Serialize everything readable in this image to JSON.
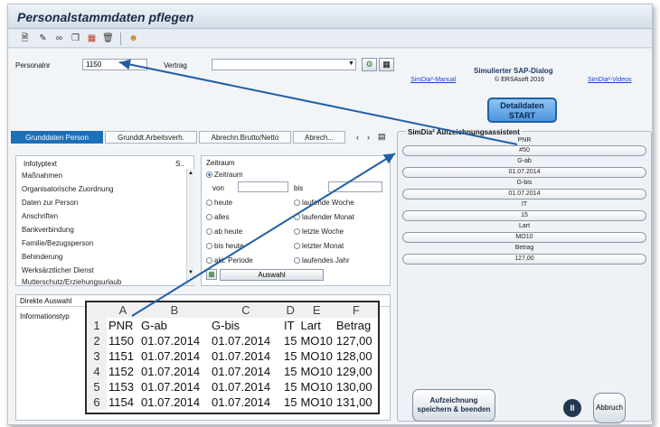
{
  "window": {
    "title": "Personalstammdaten pflegen"
  },
  "toolbar": {
    "icons": [
      "new-document-icon",
      "edit-pencil-icon",
      "glasses-icon",
      "copy-icon",
      "overview-icon",
      "delete-trash-icon",
      "person-icon"
    ]
  },
  "header": {
    "personalnr_label": "Personalnr",
    "personalnr_value": "1150",
    "vertrag_label": "Vertrag",
    "vertrag_value": ""
  },
  "simdia": {
    "heading": "Simulierter SAP-Dialog",
    "copyright": "© ERSAsoft 2016",
    "manual_link": "SimDia²-Manual",
    "videos_link": "SimDia²-Videos",
    "detail_button_line1": "Detaildaten",
    "detail_button_line2": "START",
    "assistant_title": "SimDia² Aufzeichnungsassistent",
    "fields": [
      {
        "label": "PNR",
        "value": "#50"
      },
      {
        "label": "G-ab",
        "value": "01.07.2014"
      },
      {
        "label": "G-bis",
        "value": "01.07.2014"
      },
      {
        "label": "IT",
        "value": "15"
      },
      {
        "label": "Lart",
        "value": "MO10"
      },
      {
        "label": "Betrag",
        "value": "127,00"
      }
    ],
    "save_button_line1": "Aufzeichnung",
    "save_button_line2": "speichern & beenden",
    "cancel_button": "Abbruch"
  },
  "tabs": [
    {
      "label": "Grunddaten Person",
      "active": true
    },
    {
      "label": "Grunddt.Arbeitsverh.",
      "active": false
    },
    {
      "label": "Abrechn.Brutto/Netto",
      "active": false
    },
    {
      "label": "Abrech...",
      "active": false
    }
  ],
  "infotypes": {
    "col_label": "Infotyptext",
    "col_status": "S..",
    "items": [
      "Maßnahmen",
      "Organisatorische Zuordnung",
      "Daten zur Person",
      "Anschriften",
      "Bankverbindung",
      "Familie/Bezugsperson",
      "Behinderung",
      "Werksärztlicher Dienst",
      "Mutterschutz/Erziehungsurlaub"
    ]
  },
  "zeitraum": {
    "title": "Zeitraum",
    "selected_label": "Zeitraum",
    "von_label": "von",
    "bis_label": "bis",
    "options_left": [
      "heute",
      "alles",
      "ab heute",
      "bis heute",
      "akt. Periode"
    ],
    "options_right": [
      "laufende Woche",
      "laufender Monat",
      "letzte Woche",
      "letzter Monat",
      "laufendes Jahr"
    ],
    "auswahl_button": "Auswahl"
  },
  "direkte_auswahl": {
    "title": "Direkte Auswahl",
    "infotyp_label": "Informationstyp"
  },
  "spreadsheet": {
    "columns": [
      "A",
      "B",
      "C",
      "D",
      "E",
      "F"
    ],
    "rows": [
      [
        "1",
        "PNR",
        "G-ab",
        "G-bis",
        "IT",
        "Lart",
        "Betrag"
      ],
      [
        "2",
        "1150",
        "01.07.2014",
        "01.07.2014",
        "15",
        "MO10",
        "127,00"
      ],
      [
        "3",
        "1151",
        "01.07.2014",
        "01.07.2014",
        "15",
        "MO10",
        "128,00"
      ],
      [
        "4",
        "1152",
        "01.07.2014",
        "01.07.2014",
        "15",
        "MO10",
        "129,00"
      ],
      [
        "5",
        "1153",
        "01.07.2014",
        "01.07.2014",
        "15",
        "MO10",
        "130,00"
      ],
      [
        "6",
        "1154",
        "01.07.2014",
        "01.07.2014",
        "15",
        "MO10",
        "131,00"
      ]
    ]
  },
  "colors": {
    "accent": "#1d6fb8",
    "arrow": "#1f5fa8",
    "detail_button": "#5aa0e6"
  }
}
